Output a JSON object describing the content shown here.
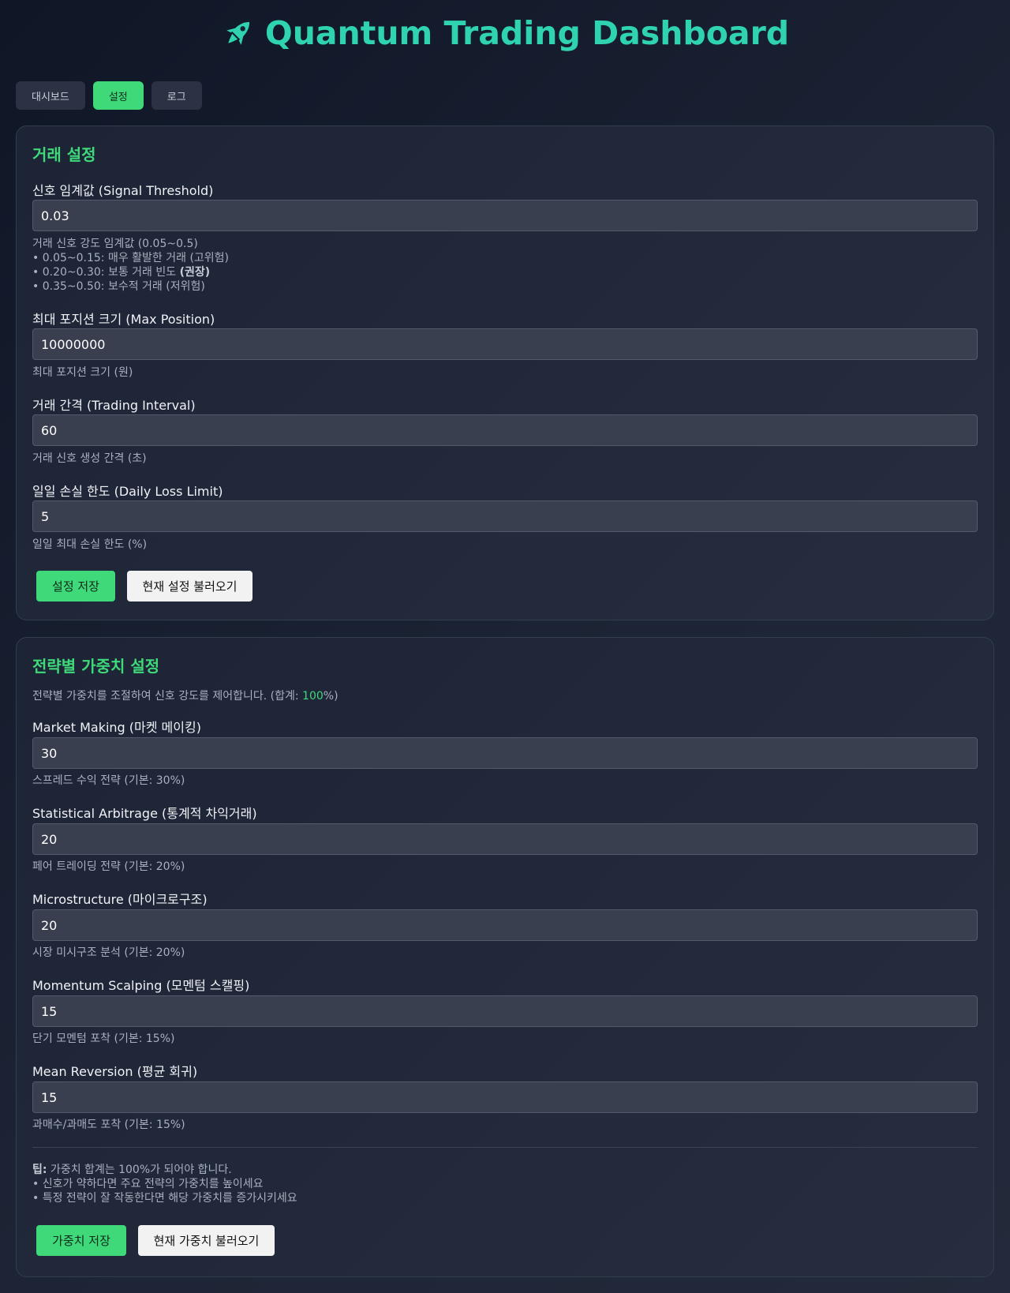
{
  "header": {
    "title": "Quantum Trading Dashboard",
    "icon": "rocket-icon",
    "color": "#2fd3b0"
  },
  "tabs": [
    {
      "label": "대시보드",
      "active": false
    },
    {
      "label": "설정",
      "active": true
    },
    {
      "label": "로그",
      "active": false
    }
  ],
  "trading": {
    "title": "거래 설정",
    "fields": [
      {
        "label": "신호 임계값 (Signal Threshold)",
        "value": "0.03",
        "help": [
          "거래 신호 강도 임계값 (0.05~0.5)",
          "• 0.05~0.15: 매우 활발한 거래 (고위험)",
          "• 0.20~0.30: 보통 거래 빈도 ",
          "• 0.35~0.50: 보수적 거래 (저위험)"
        ],
        "help_bold": "(권장)"
      },
      {
        "label": "최대 포지션 크기 (Max Position)",
        "value": "10000000",
        "help": "최대 포지션 크기 (원)"
      },
      {
        "label": "거래 간격 (Trading Interval)",
        "value": "60",
        "help": "거래 신호 생성 간격 (초)"
      },
      {
        "label": "일일 손실 한도 (Daily Loss Limit)",
        "value": "5",
        "help": "일일 최대 손실 한도 (%)"
      }
    ],
    "save_label": "설정 저장",
    "load_label": "현재 설정 불러오기"
  },
  "weights": {
    "title": "전략별 가중치 설정",
    "intro_prefix": "전략별 가중치를 조절하여 신호 강도를 제어합니다. (합계: ",
    "intro_sum": "100",
    "intro_suffix": "%)",
    "fields": [
      {
        "label": "Market Making (마켓 메이킹)",
        "value": "30",
        "help": "스프레드 수익 전략 (기본: 30%)"
      },
      {
        "label": "Statistical Arbitrage (통계적 차익거래)",
        "value": "20",
        "help": "페어 트레이딩 전략 (기본: 20%)"
      },
      {
        "label": "Microstructure (마이크로구조)",
        "value": "20",
        "help": "시장 미시구조 분석 (기본: 20%)"
      },
      {
        "label": "Momentum Scalping (모멘텀 스캘핑)",
        "value": "15",
        "help": "단기 모멘텀 포착 (기본: 15%)"
      },
      {
        "label": "Mean Reversion (평균 회귀)",
        "value": "15",
        "help": "과매수/과매도 포착 (기본: 15%)"
      }
    ],
    "tip_bold": "팁:",
    "tip_lines": [
      " 가중치 합계는 100%가 되어야 합니다.",
      "• 신호가 약하다면 주요 전략의 가중치를 높이세요",
      "• 특정 전략이 잘 작동한다면 해당 가중치를 증가시키세요"
    ],
    "save_label": "가중치 저장",
    "load_label": "현재 가중치 불러오기"
  },
  "colors": {
    "accent": "#3fd97a",
    "title": "#2fd3b0"
  }
}
